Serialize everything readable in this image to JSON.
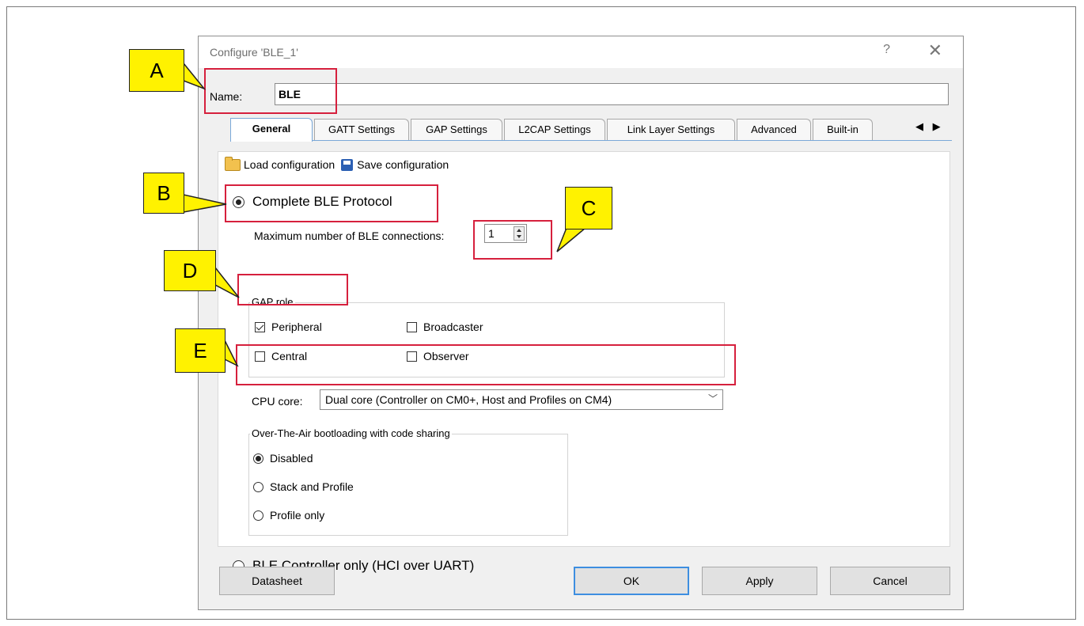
{
  "dialog": {
    "title": "Configure 'BLE_1'",
    "help_glyph": "?",
    "close_glyph": "✕"
  },
  "name_field": {
    "label": "Name:",
    "value": "BLE"
  },
  "tabs": [
    {
      "label": "General",
      "active": true
    },
    {
      "label": "GATT Settings",
      "active": false
    },
    {
      "label": "GAP Settings",
      "active": false
    },
    {
      "label": "L2CAP Settings",
      "active": false
    },
    {
      "label": "Link Layer Settings",
      "active": false
    },
    {
      "label": "Advanced",
      "active": false
    },
    {
      "label": "Built-in",
      "active": false
    }
  ],
  "tab_scroll_glyphs": "◀ ▶",
  "toolbar": {
    "load_label": "Load configuration",
    "save_label": "Save configuration"
  },
  "protocol": {
    "complete_label": "Complete BLE Protocol",
    "complete_selected": true,
    "controller_only_label": "BLE Controller only (HCI over UART)",
    "controller_only_selected": false
  },
  "max_connections": {
    "label": "Maximum number of BLE connections:",
    "value": "1"
  },
  "gap_role": {
    "title": "GAP role",
    "peripheral": {
      "label": "Peripheral",
      "checked": true
    },
    "broadcaster": {
      "label": "Broadcaster",
      "checked": false
    },
    "central": {
      "label": "Central",
      "checked": false
    },
    "observer": {
      "label": "Observer",
      "checked": false
    }
  },
  "cpu_core": {
    "label": "CPU core:",
    "value": "Dual core (Controller on CM0+, Host and Profiles on CM4)",
    "chevron": "﹀"
  },
  "ota": {
    "title": "Over-The-Air bootloading with code sharing",
    "options": [
      {
        "label": "Disabled",
        "selected": true
      },
      {
        "label": "Stack and Profile",
        "selected": false
      },
      {
        "label": "Profile only",
        "selected": false
      }
    ]
  },
  "buttons": {
    "datasheet": "Datasheet",
    "ok": "OK",
    "apply": "Apply",
    "cancel": "Cancel"
  },
  "callouts": {
    "a": "A",
    "b": "B",
    "c": "C",
    "d": "D",
    "e": "E"
  },
  "colors": {
    "callout_fill": "#fff200",
    "highlight": "#d6203d",
    "tab_border": "#7aa8d8"
  }
}
